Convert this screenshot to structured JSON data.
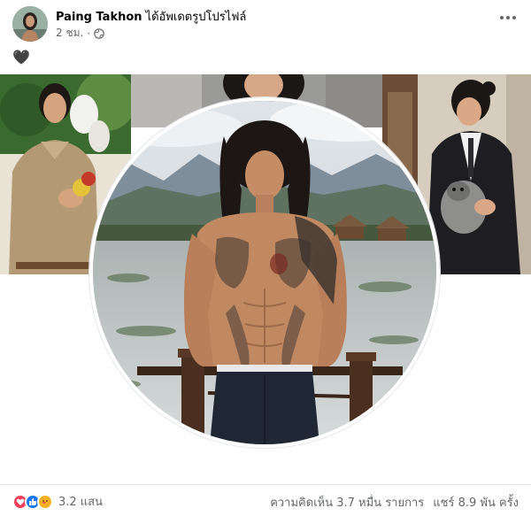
{
  "post": {
    "author": "Paing Takhon",
    "action": "ได้อัพเดตรูปโปรไฟล์",
    "time": "2 ชม.",
    "separator": "·",
    "caption": "🖤",
    "privacy_icon": "globe-icon",
    "more_icon": "more-options-icon"
  },
  "footer": {
    "reaction_icons": [
      "love-reaction-icon",
      "like-reaction-icon",
      "care-reaction-icon"
    ],
    "reaction_count": "3.2 แสน",
    "comments": "ความคิดเห็น 3.7 หมื่น รายการ",
    "shares": "แชร์ 8.9 พัน ครั้ง"
  },
  "colors": {
    "secondary_text": "#65676b",
    "like_blue": "#1877f2",
    "love_red": "#f33e58",
    "care_yellow": "#f7b125",
    "border": "#e4e6eb"
  }
}
